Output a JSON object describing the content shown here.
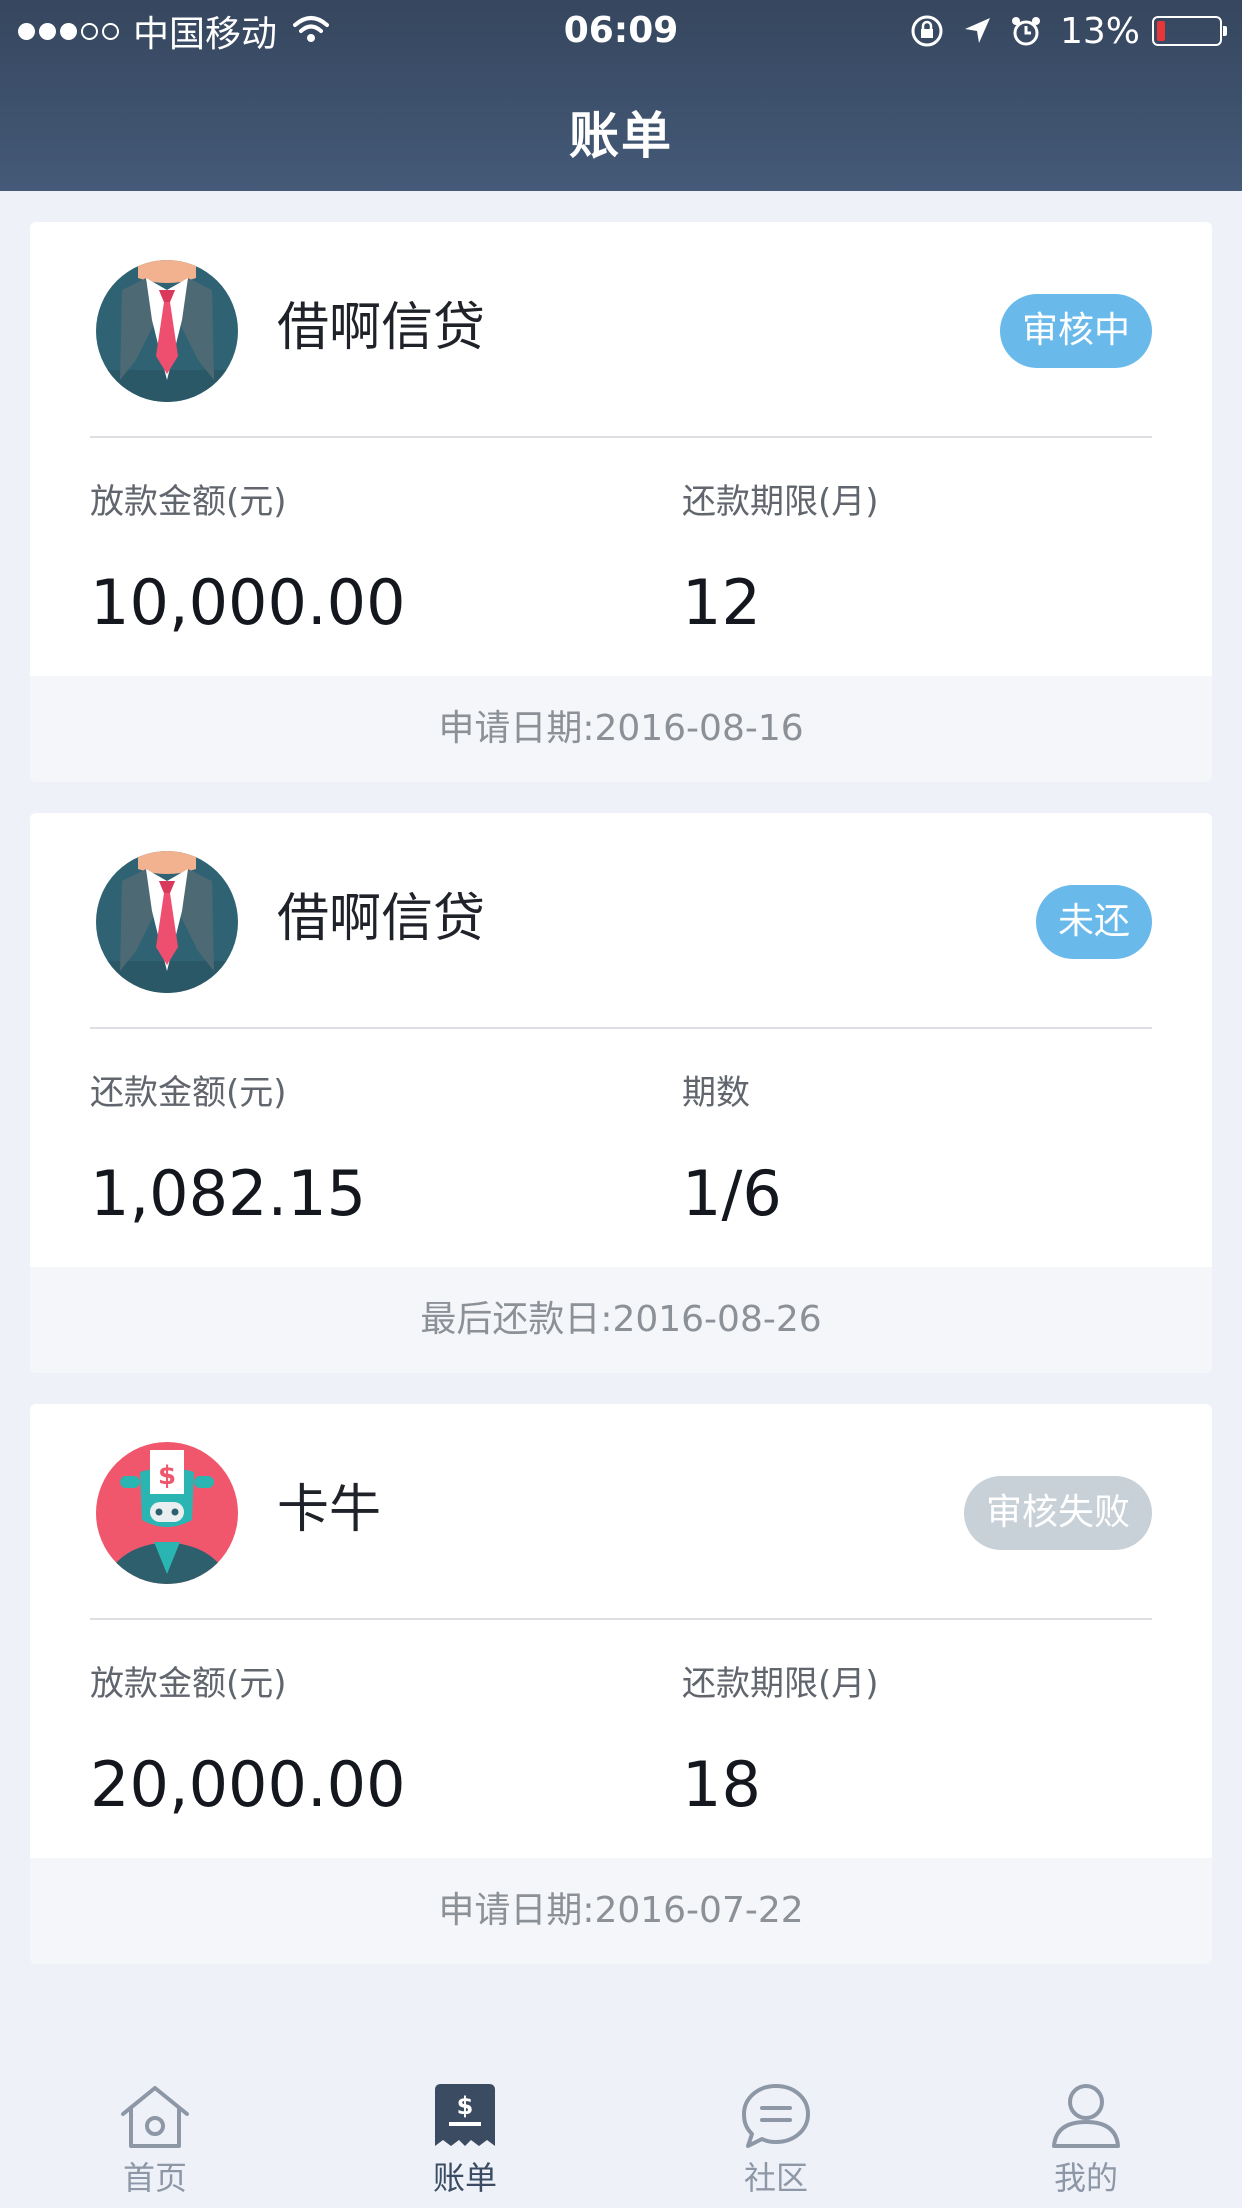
{
  "status_bar": {
    "carrier": "中国移动",
    "time": "06:09",
    "battery_percent": "13%",
    "battery_level": 0.13,
    "signal_bars": 3,
    "signal_total": 5
  },
  "header": {
    "title": "账单"
  },
  "colors": {
    "header_top": "#36465e",
    "badge_blue": "#6ab9eb",
    "badge_gray": "#c8d0d8",
    "tab_active": "#3b4b62",
    "tab_inactive": "#8d97a6"
  },
  "cards": [
    {
      "lender": "借啊信贷",
      "avatar": "businessman-avatar-icon",
      "status": "审核中",
      "status_color": "#6ab9eb",
      "left_label": "放款金额(元)",
      "left_value": "10,000.00",
      "right_label": "还款期限(月)",
      "right_value": "12",
      "footer": "申请日期:2016-08-16"
    },
    {
      "lender": "借啊信贷",
      "avatar": "businessman-avatar-icon",
      "status": "未还",
      "status_color": "#6ab9eb",
      "left_label": "还款金额(元)",
      "left_value": "1,082.15",
      "right_label": "期数",
      "right_value": "1/6",
      "footer": "最后还款日:2016-08-26"
    },
    {
      "lender": "卡牛",
      "avatar": "cow-avatar-icon",
      "status": "审核失败",
      "status_color": "#c8d0d8",
      "left_label": "放款金额(元)",
      "left_value": "20,000.00",
      "right_label": "还款期限(月)",
      "right_value": "18",
      "footer": "申请日期:2016-07-22"
    }
  ],
  "tabs": [
    {
      "label": "首页",
      "icon": "home-icon",
      "active": false
    },
    {
      "label": "账单",
      "icon": "bill-icon",
      "active": true
    },
    {
      "label": "社区",
      "icon": "chat-icon",
      "active": false
    },
    {
      "label": "我的",
      "icon": "profile-icon",
      "active": false
    }
  ]
}
